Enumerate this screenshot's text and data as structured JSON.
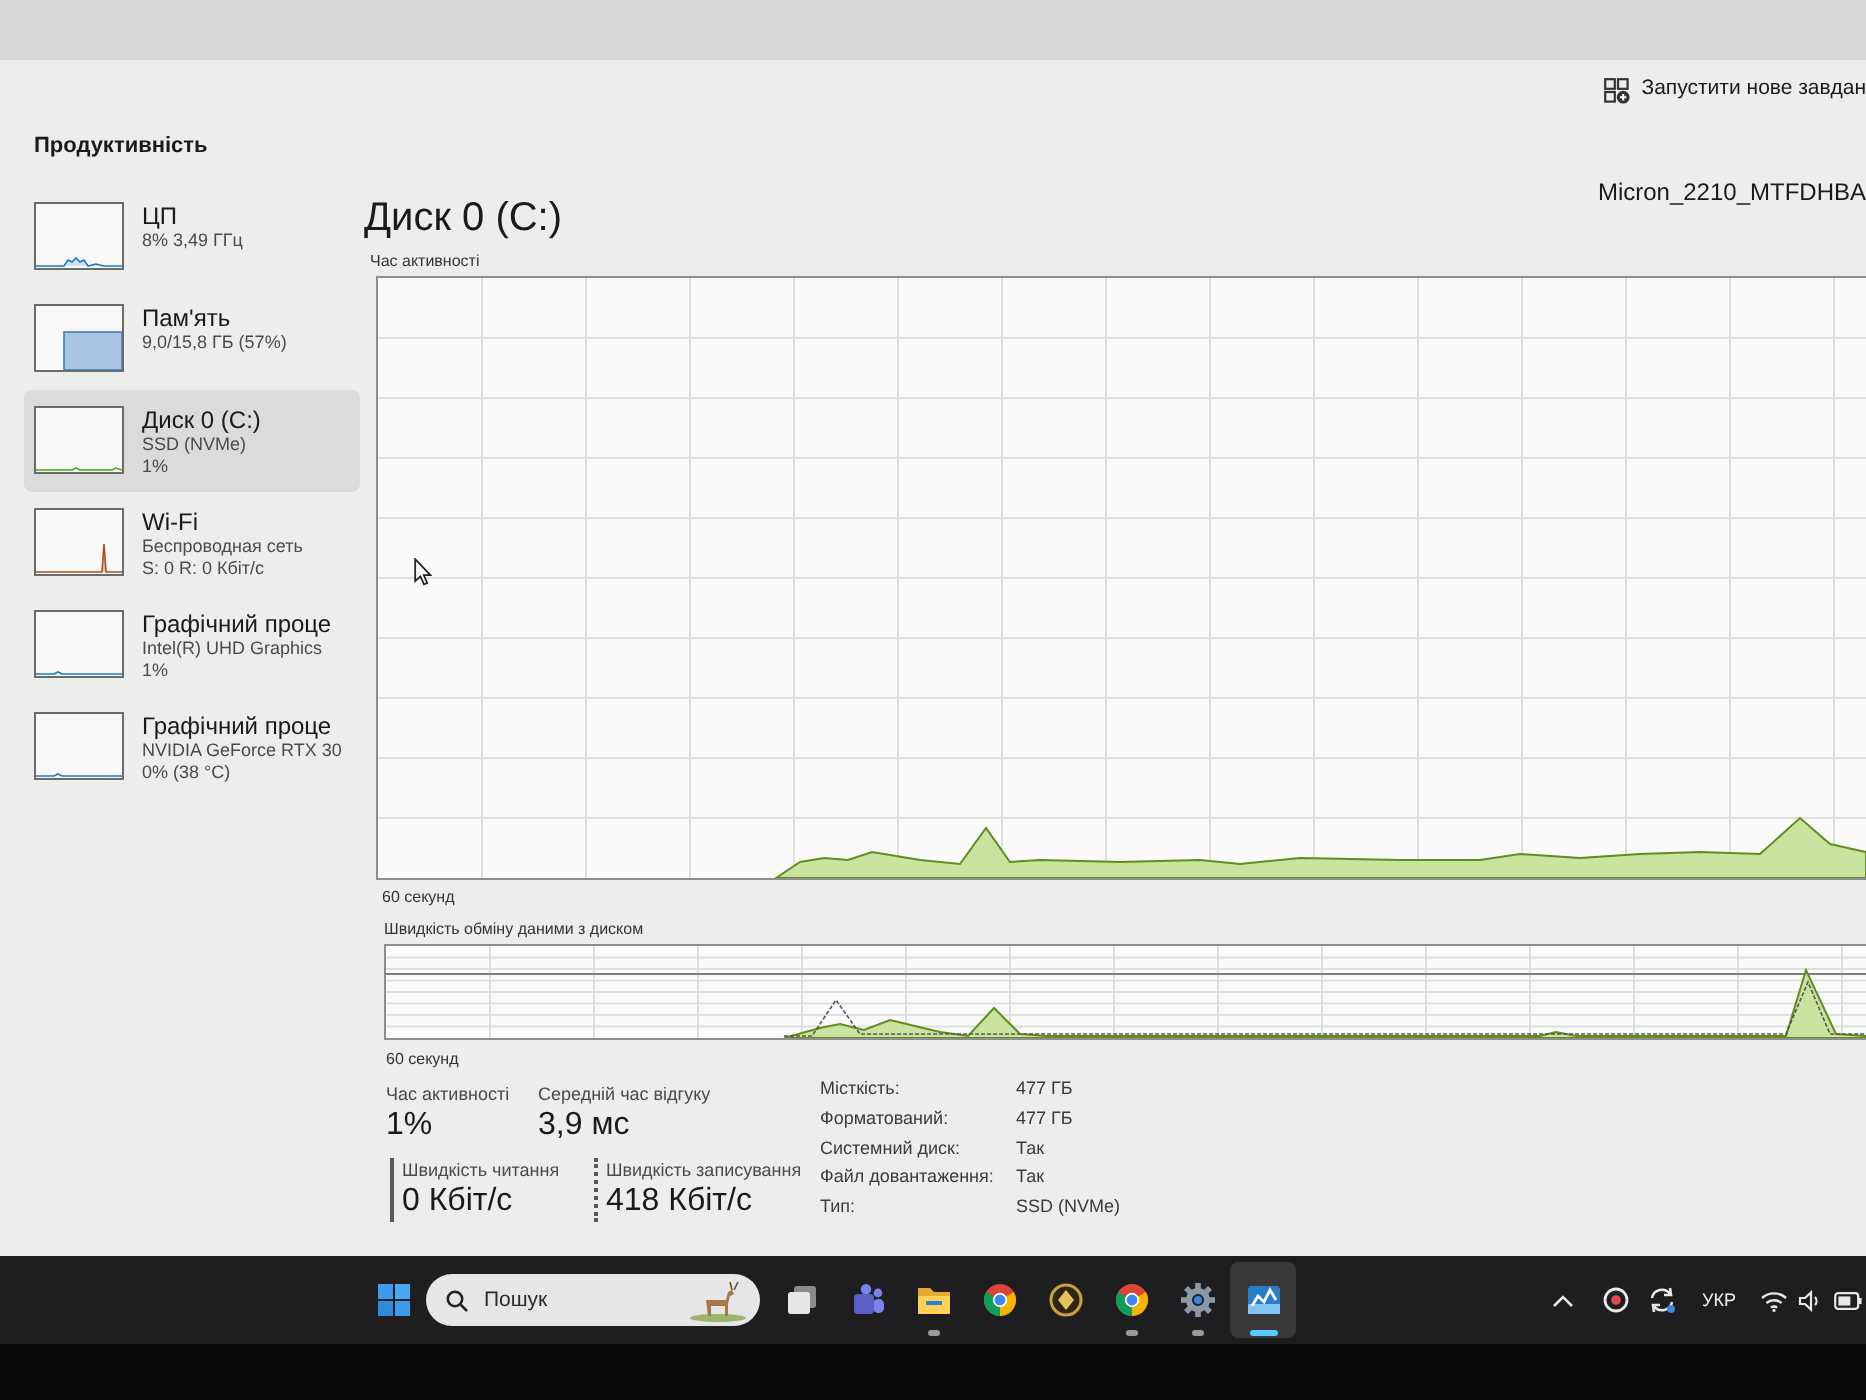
{
  "toolbar": {
    "run_task_button": "Запустити нове завдан"
  },
  "sidebar": {
    "title": "Продуктивність",
    "items": [
      {
        "kind": "cpu",
        "title": "ЦП",
        "lines": [
          "8% 3,49 ГГц"
        ],
        "selected": false
      },
      {
        "kind": "memory",
        "title": "Пам'ять",
        "lines": [
          "9,0/15,8 ГБ (57%)"
        ],
        "selected": false
      },
      {
        "kind": "disk",
        "title": "Диск 0 (C:)",
        "lines": [
          "SSD (NVMe)",
          "1%"
        ],
        "selected": true
      },
      {
        "kind": "network",
        "title": "Wi-Fi",
        "lines": [
          "Беспроводная сеть",
          "S: 0 R: 0 Кбіт/с"
        ],
        "selected": false
      },
      {
        "kind": "gpu",
        "title": "Графічний проце",
        "lines": [
          "Intel(R) UHD Graphics",
          "1%"
        ],
        "selected": false
      },
      {
        "kind": "gpu",
        "title": "Графічний проце",
        "lines": [
          "NVIDIA GeForce RTX 30",
          "0% (38 °C)"
        ],
        "selected": false
      }
    ]
  },
  "main": {
    "title": "Диск 0 (C:)",
    "model": "Micron_2210_MTFDHBA",
    "charts": [
      {
        "kind": "activity",
        "label": "Час активності",
        "time_label": "60 секунд"
      },
      {
        "kind": "transfer",
        "label": "Швидкість обміну даними з диском",
        "time_label": "60 секунд"
      }
    ],
    "stats": [
      [
        {
          "kind": "plain",
          "label": "Час активності",
          "value": "1%"
        },
        {
          "kind": "plain",
          "label": "Середній час відгуку",
          "value": "3,9 мс"
        }
      ],
      [
        {
          "kind": "read",
          "label": "Швидкість читання",
          "value": "0 Кбіт/с"
        },
        {
          "kind": "write",
          "label": "Швидкість записування",
          "value": "418 Кбіт/с"
        }
      ]
    ],
    "properties": [
      {
        "label": "Місткість:",
        "value": "477 ГБ"
      },
      {
        "label": "Форматований:",
        "value": "477 ГБ"
      },
      {
        "label": "Системний диск:",
        "value": "Так"
      },
      {
        "label": "Файл довантаження:",
        "value": "Так"
      },
      {
        "label": "Тип:",
        "value": "SSD (NVMe)"
      }
    ]
  },
  "taskbar": {
    "search": {
      "placeholder": "Пошук"
    },
    "apps": [
      {
        "running": false,
        "selected": false
      },
      {
        "running": false,
        "selected": false
      },
      {
        "running": true,
        "selected": false
      },
      {
        "running": false,
        "selected": false
      },
      {
        "running": false,
        "selected": false
      },
      {
        "running": true,
        "selected": false
      },
      {
        "running": true,
        "selected": false
      },
      {
        "running": true,
        "selected": true
      }
    ],
    "language": "УКР"
  }
}
